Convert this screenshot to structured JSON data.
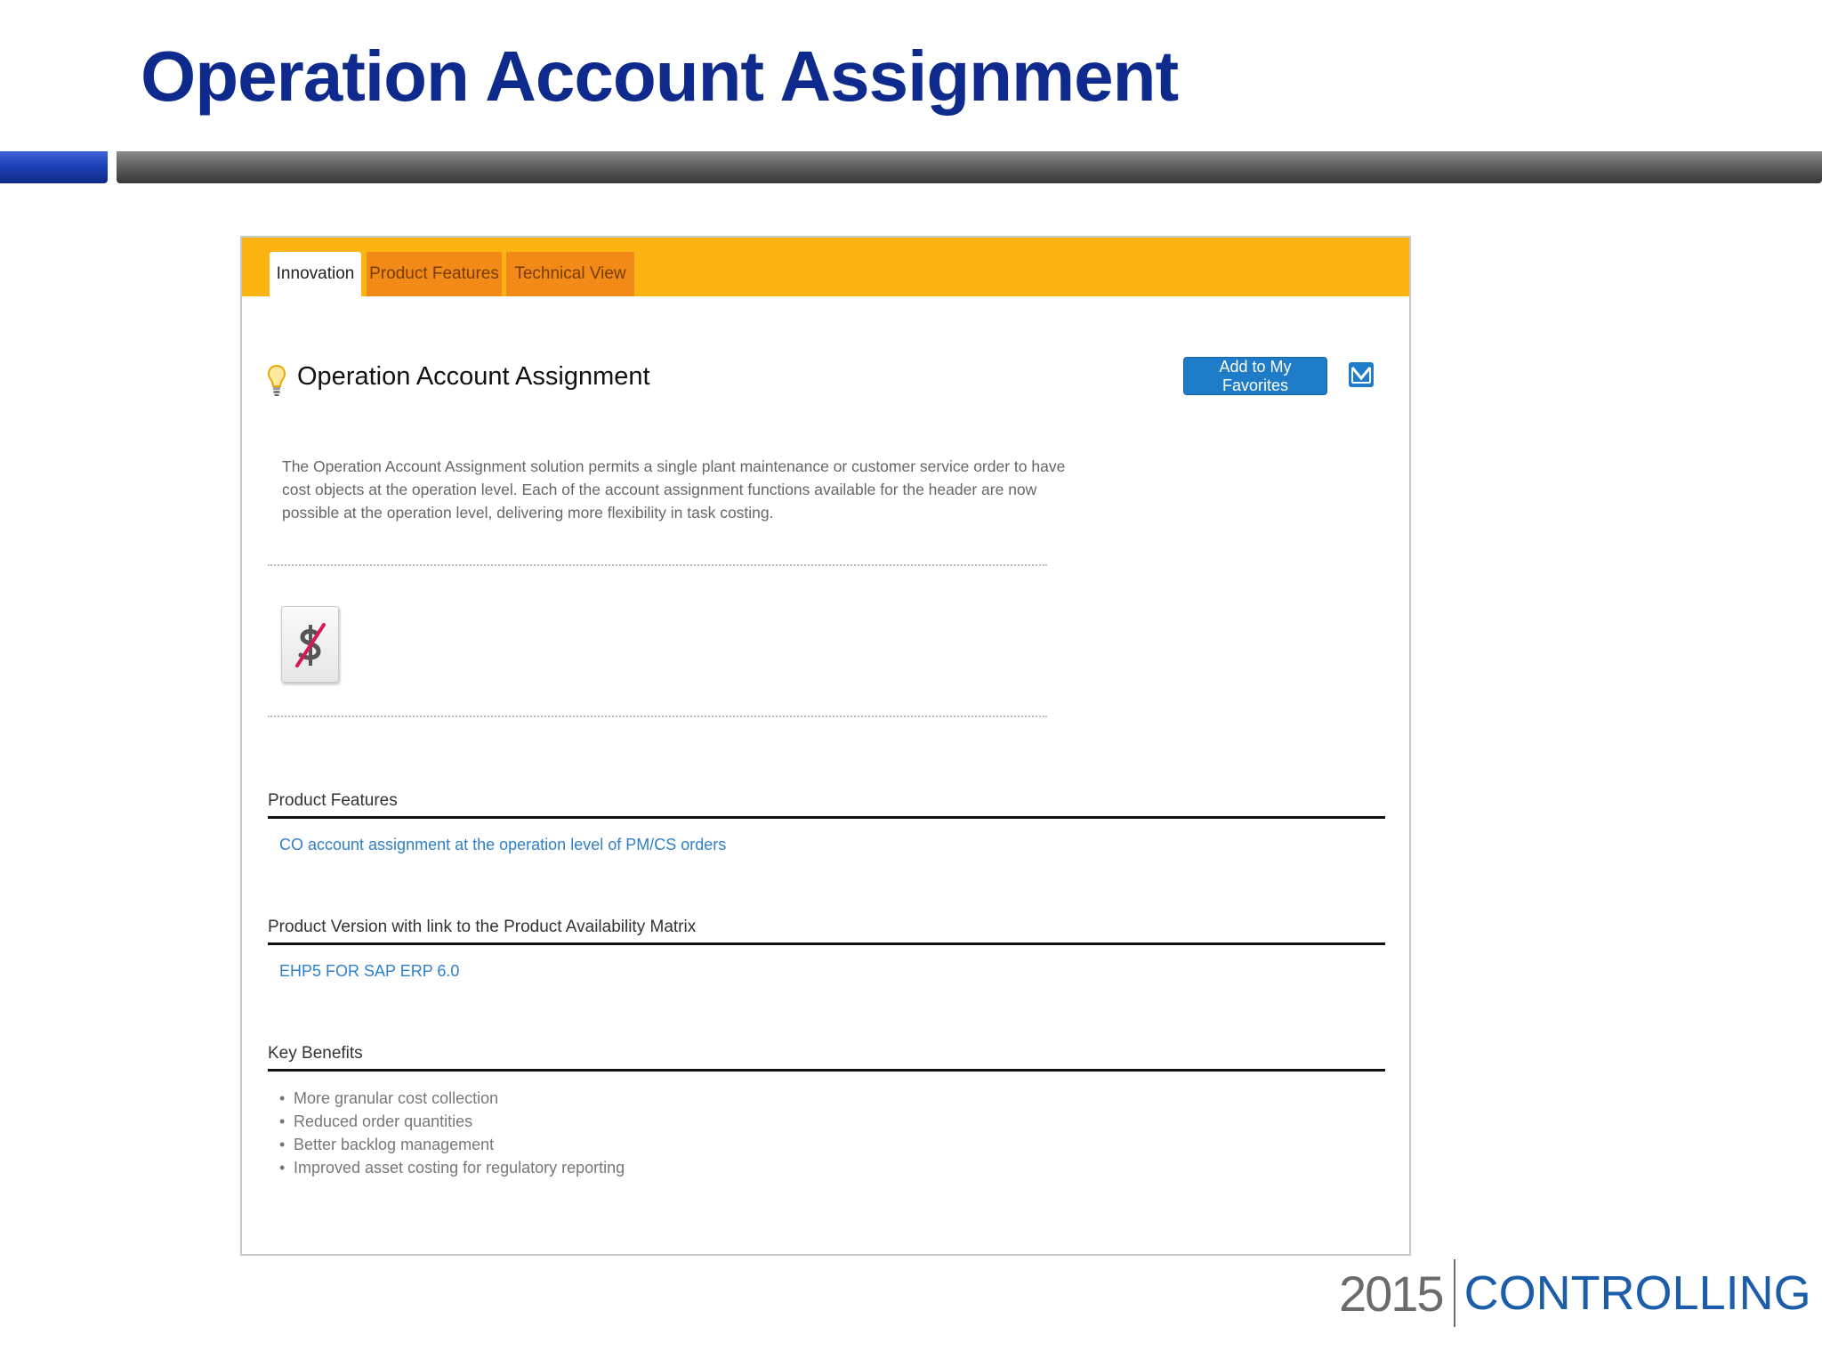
{
  "slide": {
    "title": "Operation Account Assignment"
  },
  "tabs": [
    {
      "label": "Innovation",
      "active": true
    },
    {
      "label": "Product Features",
      "active": false
    },
    {
      "label": "Technical View",
      "active": false
    }
  ],
  "header": {
    "title": "Operation Account Assignment",
    "favorites_label": "Add to My Favorites"
  },
  "description": "The Operation Account Assignment solution permits a single plant maintenance or customer service order to have cost objects at the operation level. Each of the account assignment functions available for the header are now possible at the operation level, delivering more flexibility in task costing.",
  "sections": {
    "features": {
      "heading": "Product Features",
      "link": "CO account assignment at the operation level of PM/CS orders"
    },
    "version": {
      "heading": "Product Version with link to the Product Availability Matrix",
      "link": "EHP5 FOR SAP ERP 6.0"
    },
    "benefits": {
      "heading": "Key Benefits",
      "items": [
        "More granular cost collection",
        "Reduced order quantities",
        "Better backlog management",
        "Improved asset costing for regulatory reporting"
      ]
    }
  },
  "brand": {
    "year": "2015",
    "name": "CONTROLLING"
  },
  "colors": {
    "title_blue": "#0d2a8c",
    "tabbar_orange": "#fcb412",
    "tab_orange": "#f18a16",
    "button_blue": "#1f7cc9",
    "link_blue": "#2f80c9",
    "brand_blue": "#1b5da8"
  },
  "icons": {
    "bulb": "lightbulb-icon",
    "mail": "mail-icon",
    "tile": "no-cost-icon"
  }
}
